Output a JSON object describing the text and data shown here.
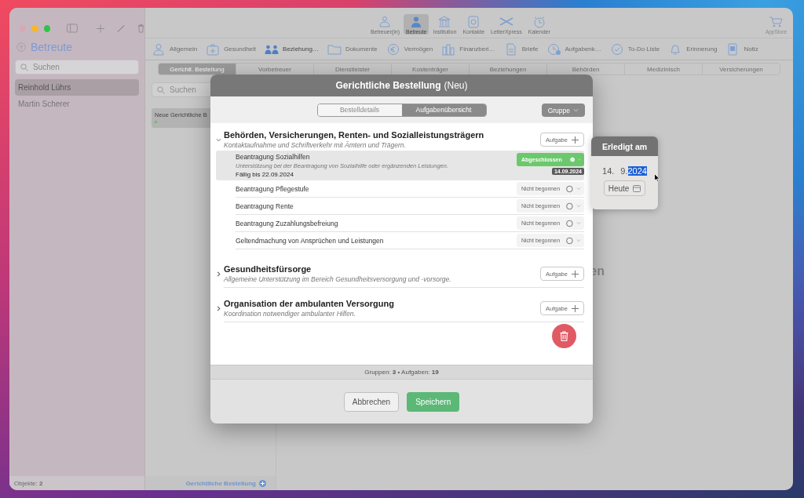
{
  "toolbar": {
    "nav": [
      {
        "label": "Betreuer(in)",
        "selected": false
      },
      {
        "label": "Betreute",
        "selected": true
      },
      {
        "label": "Institution",
        "selected": false
      },
      {
        "label": "Kontakte",
        "selected": false
      },
      {
        "label": "LetterXpress",
        "selected": false
      },
      {
        "label": "Kalender",
        "selected": false
      }
    ],
    "store": "AppStore"
  },
  "sidebar": {
    "title": "Betreute",
    "search_placeholder": "Suchen",
    "items": [
      {
        "name": "Reinhold Lührs",
        "selected": true
      },
      {
        "name": "Martin Scherer",
        "selected": false
      }
    ],
    "footer": "Objekte: **2**"
  },
  "sections": [
    {
      "label": "Allgemein",
      "selected": false
    },
    {
      "label": "Gesundheit",
      "selected": false
    },
    {
      "label": "Beziehung…",
      "selected": true
    },
    {
      "label": "Dokumente",
      "selected": false
    },
    {
      "label": "Vermögen",
      "selected": false
    },
    {
      "label": "Finanzberi…",
      "selected": false
    },
    {
      "label": "Briefe",
      "selected": false
    },
    {
      "label": "Aufgabenk…",
      "selected": false
    },
    {
      "label": "To-Do Liste",
      "selected": false
    },
    {
      "label": "Erinnerung",
      "selected": false
    },
    {
      "label": "Notiz",
      "selected": false
    }
  ],
  "subtabs": [
    {
      "label": "Gerichtl. Bestellung",
      "selected": true
    },
    {
      "label": "Vorbetreuer",
      "selected": false
    },
    {
      "label": "Dienstleister",
      "selected": false
    },
    {
      "label": "Kostenträger",
      "selected": false
    },
    {
      "label": "Beziehungen",
      "selected": false
    },
    {
      "label": "Behörden",
      "selected": false
    },
    {
      "label": "Medizinisch",
      "selected": false
    },
    {
      "label": "Versicherungen",
      "selected": false
    }
  ],
  "list": {
    "search_placeholder": "Suchen",
    "items": [
      {
        "title": "Neue Gerichtliche B",
        "selected": true
      }
    ],
    "footer_link": "Gerichtliche Bestellung"
  },
  "main": {
    "background_text": "en"
  },
  "dialog": {
    "title": "Gerichtliche Bestellung",
    "title_suffix": "(Neu)",
    "segments": [
      {
        "label": "Bestelldetails",
        "selected": false
      },
      {
        "label": "Aufgabenübersicht",
        "selected": true
      }
    ],
    "group_button": "Gruppe",
    "groups": [
      {
        "title": "Behörden, Versicherungen, Renten- und Sozialleistungsträgern",
        "subtitle": "Kontaktaufnahme und Schriftverkehr mit Ämtern und Trägern.",
        "expanded": true,
        "add_button": "Aufgabe",
        "tasks": [
          {
            "title": "Beantragung Sozialhilfen",
            "description": "Unterstützung bei der Beantragung von Sozialhilfe oder ergänzenden Leistungen.",
            "due": "Fällig bis 22.09.2024",
            "status": "Abgeschlossen",
            "done": true,
            "date_badge": "14.09.2024",
            "selected": true
          },
          {
            "title": "Beantragung Pflegestufe",
            "status": "Nicht begonnen",
            "done": false,
            "selected": false
          },
          {
            "title": "Beantragung Rente",
            "status": "Nicht begonnen",
            "done": false,
            "selected": false
          },
          {
            "title": "Beantragung Zuzahlungsbefreiung",
            "status": "Nicht begonnen",
            "done": false,
            "selected": false
          },
          {
            "title": "Geltendmachung von Ansprüchen und Leistungen",
            "status": "Nicht begonnen",
            "done": false,
            "selected": false
          }
        ]
      },
      {
        "title": "Gesundheitsfürsorge",
        "subtitle": "Allgemeine Unterstützung im Bereich Gesundheitsversorgung und -vorsorge.",
        "expanded": false,
        "add_button": "Aufgabe"
      },
      {
        "title": "Organisation der ambulanten Versorgung",
        "subtitle": "Koordination notwendiger ambulanter Hilfen.",
        "expanded": false,
        "add_button": "Aufgabe"
      }
    ],
    "summary": "Gruppen: **3** • Aufgaben: **19**",
    "buttons": [
      {
        "label": "Abbrechen",
        "kind": "secondary"
      },
      {
        "label": "Speichern",
        "kind": "primary"
      }
    ]
  },
  "popover": {
    "title": "Erledigt am",
    "day": "14.",
    "month": "9.",
    "year": "2024",
    "today_button": "Heute"
  }
}
